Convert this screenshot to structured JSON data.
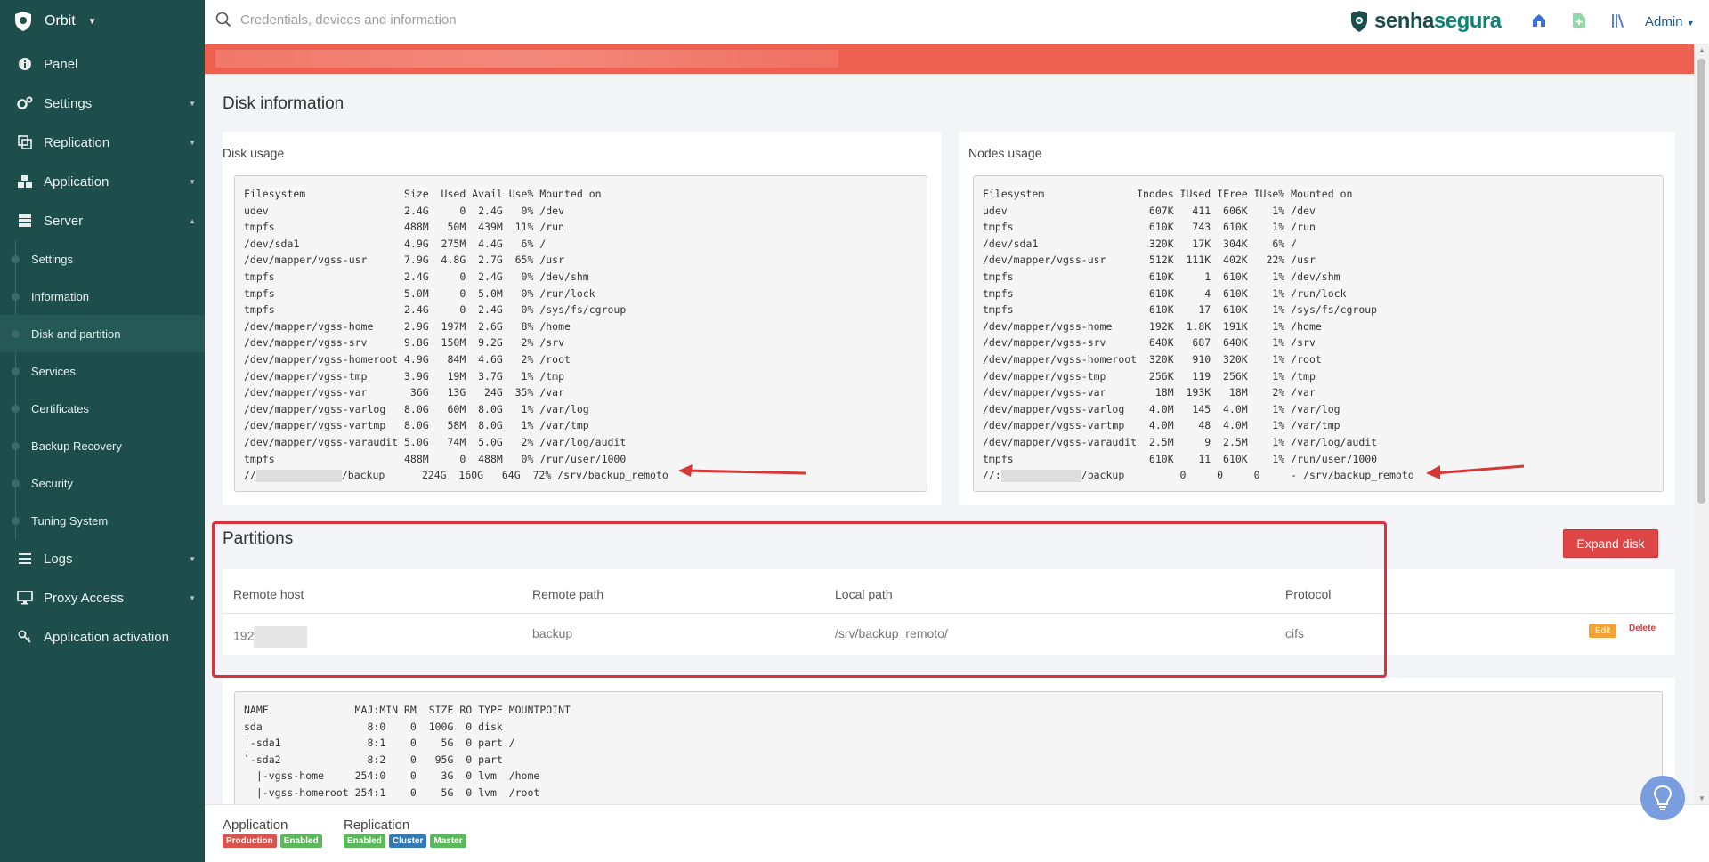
{
  "sidebar": {
    "brand": "Orbit",
    "items": [
      {
        "label": "Panel"
      },
      {
        "label": "Settings"
      },
      {
        "label": "Replication"
      },
      {
        "label": "Application"
      },
      {
        "label": "Server"
      },
      {
        "label": "Logs"
      },
      {
        "label": "Proxy Access"
      },
      {
        "label": "Application activation"
      }
    ],
    "server_sub": [
      {
        "label": "Settings"
      },
      {
        "label": "Information"
      },
      {
        "label": "Disk and partition"
      },
      {
        "label": "Services"
      },
      {
        "label": "Certificates"
      },
      {
        "label": "Backup Recovery"
      },
      {
        "label": "Security"
      },
      {
        "label": "Tuning System"
      }
    ]
  },
  "topbar": {
    "search_placeholder": "Credentials, devices and information",
    "logo_part1": "senha",
    "logo_part2": "segura",
    "user": "Admin"
  },
  "disk_info": {
    "title": "Disk information",
    "disk_usage": {
      "title": "Disk usage",
      "header": "Filesystem                Size  Used Avail Use% Mounted on",
      "lines": [
        "udev                      2.4G     0  2.4G   0% /dev",
        "tmpfs                     488M   50M  439M  11% /run",
        "/dev/sda1                 4.9G  275M  4.4G   6% /",
        "/dev/mapper/vgss-usr      7.9G  4.8G  2.7G  65% /usr",
        "tmpfs                     2.4G     0  2.4G   0% /dev/shm",
        "tmpfs                     5.0M     0  5.0M   0% /run/lock",
        "tmpfs                     2.4G     0  2.4G   0% /sys/fs/cgroup",
        "/dev/mapper/vgss-home     2.9G  197M  2.6G   8% /home",
        "/dev/mapper/vgss-srv      9.8G  150M  9.2G   2% /srv",
        "/dev/mapper/vgss-homeroot 4.9G   84M  4.6G   2% /root",
        "/dev/mapper/vgss-tmp      3.9G   19M  3.7G   1% /tmp",
        "/dev/mapper/vgss-var       36G   13G   24G  35% /var",
        "/dev/mapper/vgss-varlog   8.0G   60M  8.0G   1% /var/log",
        "/dev/mapper/vgss-vartmp   8.0G   58M  8.0G   1% /var/tmp",
        "/dev/mapper/vgss-varaudit 5.0G   74M  5.0G   2% /var/log/audit",
        "tmpfs                     488M     0  488M   0% /run/user/1000"
      ],
      "last_prefix": "//",
      "last_suffix": "/backup      224G  160G   64G  72% /srv/backup_remoto"
    },
    "nodes_usage": {
      "title": "Nodes usage",
      "header": "Filesystem               Inodes IUsed IFree IUse% Mounted on",
      "lines": [
        "udev                       607K   411  606K    1% /dev",
        "tmpfs                      610K   743  610K    1% /run",
        "/dev/sda1                  320K   17K  304K    6% /",
        "/dev/mapper/vgss-usr       512K  111K  402K   22% /usr",
        "tmpfs                      610K     1  610K    1% /dev/shm",
        "tmpfs                      610K     4  610K    1% /run/lock",
        "tmpfs                      610K    17  610K    1% /sys/fs/cgroup",
        "/dev/mapper/vgss-home      192K  1.8K  191K    1% /home",
        "/dev/mapper/vgss-srv       640K   687  640K    1% /srv",
        "/dev/mapper/vgss-homeroot  320K   910  320K    1% /root",
        "/dev/mapper/vgss-tmp       256K   119  256K    1% /tmp",
        "/dev/mapper/vgss-var        18M  193K   18M    2% /var",
        "/dev/mapper/vgss-varlog    4.0M   145  4.0M    1% /var/log",
        "/dev/mapper/vgss-vartmp    4.0M    48  4.0M    1% /var/tmp",
        "/dev/mapper/vgss-varaudit  2.5M     9  2.5M    1% /var/log/audit",
        "tmpfs                      610K    11  610K    1% /run/user/1000"
      ],
      "last_prefix": "//:",
      "last_suffix": "/backup         0     0     0     - /srv/backup_remoto"
    }
  },
  "partitions": {
    "title": "Partitions",
    "expand_button": "Expand disk",
    "columns": [
      "Remote host",
      "Remote path",
      "Local path",
      "Protocol"
    ],
    "rows": [
      {
        "remote_host": "192",
        "remote_path": "backup",
        "local_path": "/srv/backup_remoto/",
        "protocol": "cifs",
        "edit": "Edit",
        "delete": "Delete"
      }
    ]
  },
  "lsblk": {
    "lines": [
      "NAME              MAJ:MIN RM  SIZE RO TYPE MOUNTPOINT",
      "sda                 8:0    0  100G  0 disk",
      "|-sda1              8:1    0    5G  0 part /",
      "`-sda2              8:2    0   95G  0 part",
      "  |-vgss-home     254:0    0    3G  0 lvm  /home",
      "  |-vgss-homeroot 254:1    0    5G  0 lvm  /root"
    ]
  },
  "footer": {
    "application_label": "Application",
    "application_badges": [
      {
        "text": "Production",
        "color": "#d9534f"
      },
      {
        "text": "Enabled",
        "color": "#5cb85c"
      }
    ],
    "replication_label": "Replication",
    "replication_badges": [
      {
        "text": "Enabled",
        "color": "#5cb85c"
      },
      {
        "text": "Cluster",
        "color": "#337ab7"
      },
      {
        "text": "Master",
        "color": "#5cb85c"
      }
    ]
  },
  "colors": {
    "sidebar_bg": "#1e4e4b",
    "alert_bg": "#ee6150",
    "highlight_border": "#d8333d",
    "accent_blue": "#1e5b8a"
  }
}
